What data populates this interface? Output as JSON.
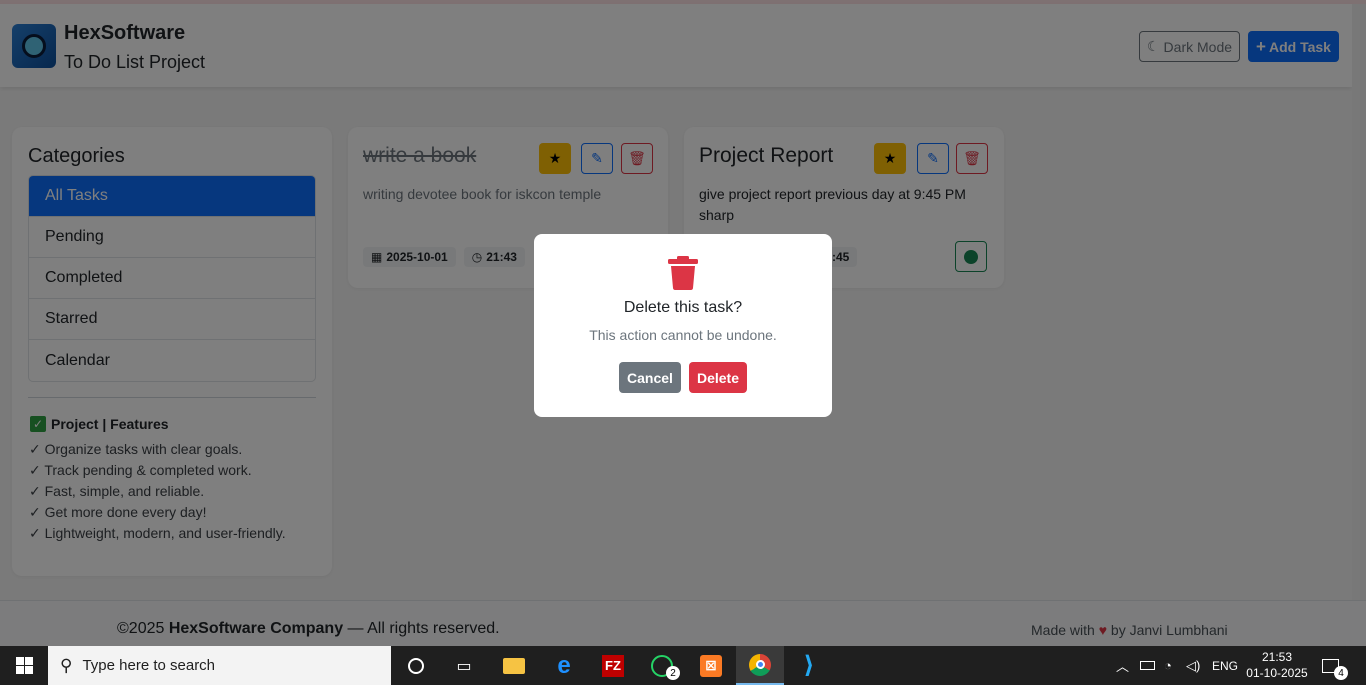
{
  "header": {
    "brand_title": "HexSoftware",
    "brand_subtitle": "To Do List Project",
    "dark_mode_label": "Dark Mode",
    "add_task_label": "Add Task"
  },
  "sidebar": {
    "title": "Categories",
    "categories": [
      {
        "label": "All Tasks",
        "active": true
      },
      {
        "label": "Pending",
        "active": false
      },
      {
        "label": "Completed",
        "active": false
      },
      {
        "label": "Starred",
        "active": false
      },
      {
        "label": "Calendar",
        "active": false
      }
    ],
    "features_title": "Project | Features",
    "features": [
      "✓ Organize tasks with clear goals.",
      "✓ Track pending & completed work.",
      "✓ Fast, simple, and reliable.",
      "✓ Get more done every day!",
      "✓ Lightweight, modern, and user-friendly."
    ]
  },
  "tasks": [
    {
      "title": "write a book",
      "description": "writing devotee book for iskcon temple",
      "date": "2025-10-01",
      "time": "21:43",
      "completed": true,
      "starred": true
    },
    {
      "title": "Project Report",
      "description": "give project report previous day at 9:45 PM sharp",
      "date": "",
      "time": ":45",
      "completed": false,
      "starred": true
    }
  ],
  "modal": {
    "title": "Delete this task?",
    "message": "This action cannot be undone.",
    "cancel_label": "Cancel",
    "delete_label": "Delete"
  },
  "footer": {
    "copyright_prefix": "©2025 ",
    "company": "HexSoftware Company",
    "copyright_suffix": " — All rights reserved.",
    "made_with": "Made with",
    "by": "by Janvi Lumbhani"
  },
  "taskbar": {
    "search_placeholder": "Type here to search",
    "whatsapp_badge": "2",
    "language": "ENG",
    "time": "21:53",
    "date": "01-10-2025",
    "notification_count": "4"
  },
  "colors": {
    "primary": "#0d6efd",
    "danger": "#dc3545",
    "warning": "#ffc107",
    "success": "#198754",
    "secondary": "#6c757d"
  }
}
